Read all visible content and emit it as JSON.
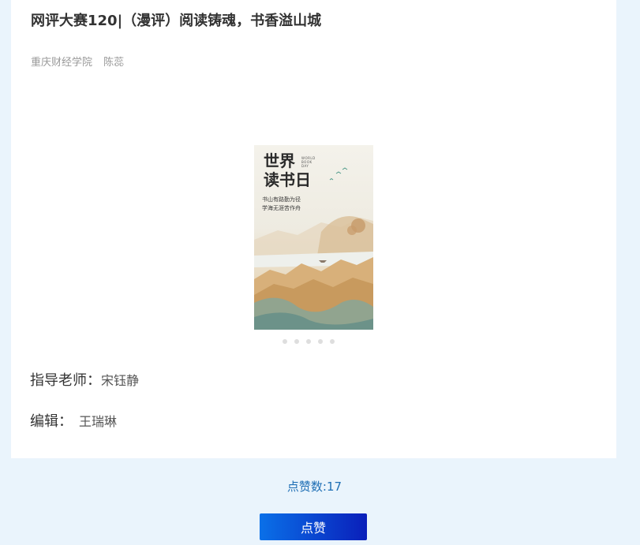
{
  "article": {
    "title": "网评大赛120|（漫评）阅读铸魂，书香溢山城",
    "school": "重庆财经学院",
    "author": "陈蕊"
  },
  "poster": {
    "title": "世界\n读书日",
    "subtitle": "WORLD BOOK DAY",
    "tagline": "书山有路勤为径\n学海无涯苦作舟",
    "carousel_dots": 5
  },
  "credits": {
    "teacher_label": "指导老师：",
    "teacher_name": "宋钰静",
    "editor_label": "编辑：",
    "editor_name": "王瑞琳"
  },
  "likes": {
    "count_text": "点赞数:17",
    "button_label": "点赞"
  }
}
